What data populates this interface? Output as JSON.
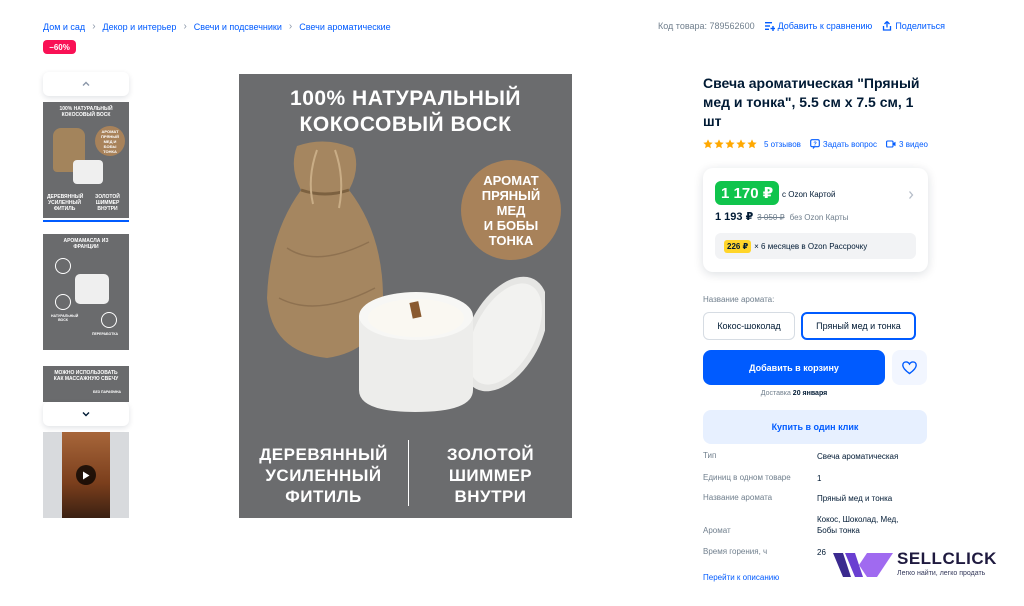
{
  "breadcrumbs": [
    "Дом и сад",
    "Декор и интерьер",
    "Свечи и подсвечники",
    "Свечи ароматические"
  ],
  "top_actions": {
    "sku": "Код товара: 789562600",
    "compare": "Добавить к сравнению",
    "share": "Поделиться"
  },
  "discount_badge": "−60%",
  "thumbnails": [
    {
      "lines": [
        "100% НАТУРАЛЬНЫЙ",
        "КОКОСОВЫЙ ВОСК"
      ],
      "bottom": [
        "ДЕРЕВЯННЫЙ",
        "УСИЛЕННЫЙ",
        "ФИТИЛЬ"
      ],
      "bottom_right": [
        "ЗОЛОТОЙ",
        "ШИММЕР",
        "ВНУТРИ"
      ],
      "circle": "АРОМАТ ПРЯНЫЙ МЕД И БОБЫ ТОНКА",
      "selected": true
    },
    {
      "lines": [
        "АРОМАМАСЛА ИЗ",
        "ФРАНЦИИ"
      ],
      "notes": [
        "ПЕРЕРАБОТАННАЯ УПАКОВКА",
        "НАТУРАЛЬНЫЙ ВОСК",
        "ПЕРЕРАБОТКА"
      ]
    },
    {
      "lines": [
        "МОЖНО ИСПОЛЬЗОВАТЬ",
        "КАК МАССАЖНУЮ СВЕЧУ"
      ],
      "note": "БЕЗ ПАРАФИНА"
    },
    {
      "video": true
    }
  ],
  "main_image": {
    "headline": [
      "100% НАТУРАЛЬНЫЙ",
      "КОКОСОВЫЙ ВОСК"
    ],
    "circle_text": [
      "АРОМАТ",
      "ПРЯНЫЙ МЕД",
      "И БОБЫ",
      "ТОНКА"
    ],
    "bottom_left": [
      "ДЕРЕВЯННЫЙ",
      "УСИЛЕННЫЙ",
      "ФИТИЛЬ"
    ],
    "bottom_right": [
      "ЗОЛОТОЙ",
      "ШИММЕР",
      "ВНУТРИ"
    ]
  },
  "product": {
    "title": "Свеча ароматическая \"Пряный мед и тонка\", 5.5 см х 7.5 см, 1 шт",
    "rating_stars": 5,
    "reviews": "5 отзывов",
    "ask": "Задать вопрос",
    "videos": "3 видео"
  },
  "price": {
    "card_price": "1 170 ₽",
    "card_caption": "с Ozon Картой",
    "regular_price": "1 193 ₽",
    "old_price": "3 050 ₽",
    "regular_caption": "без Ozon Карты",
    "installment_amount": "226 ₽",
    "installment_text": "× 6 месяцев в Ozon Рассрочку"
  },
  "aroma": {
    "label": "Название аромата:",
    "options": [
      "Кокос-шоколад",
      "Пряный мед и тонка"
    ],
    "selected": "Пряный мед и тонка"
  },
  "buttons": {
    "add_to_cart": "Добавить в корзину",
    "one_click": "Купить в один клик"
  },
  "delivery": {
    "prefix": "Доставка",
    "date": "20 января"
  },
  "specs": [
    {
      "key": "Тип",
      "value": "Свеча ароматическая"
    },
    {
      "key": "Единиц в одном товаре",
      "value": "1"
    },
    {
      "key": "Название аромата",
      "value": "Пряный мед и тонка"
    },
    {
      "key": "Аромат",
      "value": "Кокос, Шоколад, Мед, Бобы тонка"
    },
    {
      "key": "Время горения, ч",
      "value": "26"
    }
  ],
  "specs_link": "Перейти к описанию",
  "watermark": {
    "name": "SELLCLICK",
    "tagline": "Легко найти, легко продать"
  },
  "colors": {
    "accent": "#005bff",
    "green_price": "#10c44c",
    "discount": "#f91155",
    "star": "#ffa800",
    "installment": "#ffd52a"
  },
  "icons": [
    "compare-icon",
    "share-icon",
    "chevron-up-icon",
    "chevron-down-icon",
    "play-icon",
    "star-icon",
    "question-icon",
    "video-icon",
    "chevron-right-icon",
    "heart-icon"
  ]
}
